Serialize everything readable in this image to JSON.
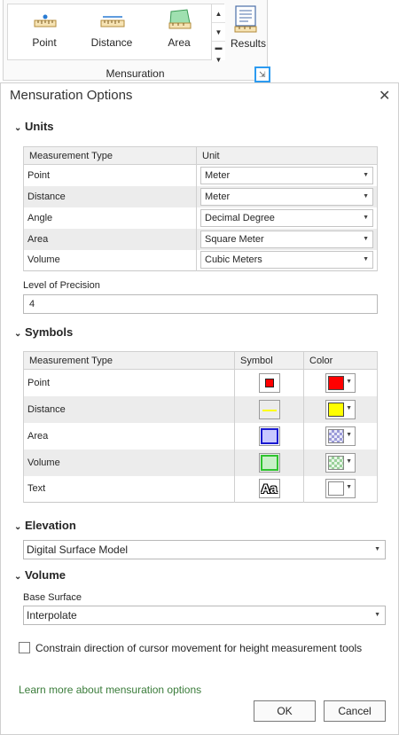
{
  "ribbon": {
    "tools": [
      {
        "label": "Point",
        "icon": "point-ruler-icon"
      },
      {
        "label": "Distance",
        "icon": "distance-ruler-icon"
      },
      {
        "label": "Area",
        "icon": "area-ruler-icon"
      }
    ],
    "results_label": "Results",
    "group_label": "Mensuration"
  },
  "dialog": {
    "title": "Mensuration Options",
    "close_glyph": "✕"
  },
  "units": {
    "heading": "Units",
    "columns": [
      "Measurement Type",
      "Unit"
    ],
    "rows": [
      {
        "type": "Point",
        "unit": "Meter"
      },
      {
        "type": "Distance",
        "unit": "Meter"
      },
      {
        "type": "Angle",
        "unit": "Decimal Degree"
      },
      {
        "type": "Area",
        "unit": "Square Meter"
      },
      {
        "type": "Volume",
        "unit": "Cubic Meters"
      }
    ],
    "precision_label": "Level of Precision",
    "precision_value": "4"
  },
  "symbols": {
    "heading": "Symbols",
    "columns": [
      "Measurement Type",
      "Symbol",
      "Color"
    ],
    "rows": [
      {
        "type": "Point",
        "color": "#ff0000"
      },
      {
        "type": "Distance",
        "color": "#ffff00"
      },
      {
        "type": "Area",
        "color": "#c8c8ff"
      },
      {
        "type": "Volume",
        "color": "#c8f0c8"
      },
      {
        "type": "Text",
        "color": "#ffffff",
        "symbol_text": "Aa"
      }
    ]
  },
  "elevation": {
    "heading": "Elevation",
    "value": "Digital Surface Model"
  },
  "volume": {
    "heading": "Volume",
    "base_surface_label": "Base Surface",
    "base_surface_value": "Interpolate"
  },
  "constrain_label": "Constrain direction of cursor movement for height measurement tools",
  "learn_more": "Learn more about mensuration options",
  "buttons": {
    "ok": "OK",
    "cancel": "Cancel"
  },
  "colors": {
    "accent": "#2d9bf0",
    "link": "#3a7c3a"
  }
}
